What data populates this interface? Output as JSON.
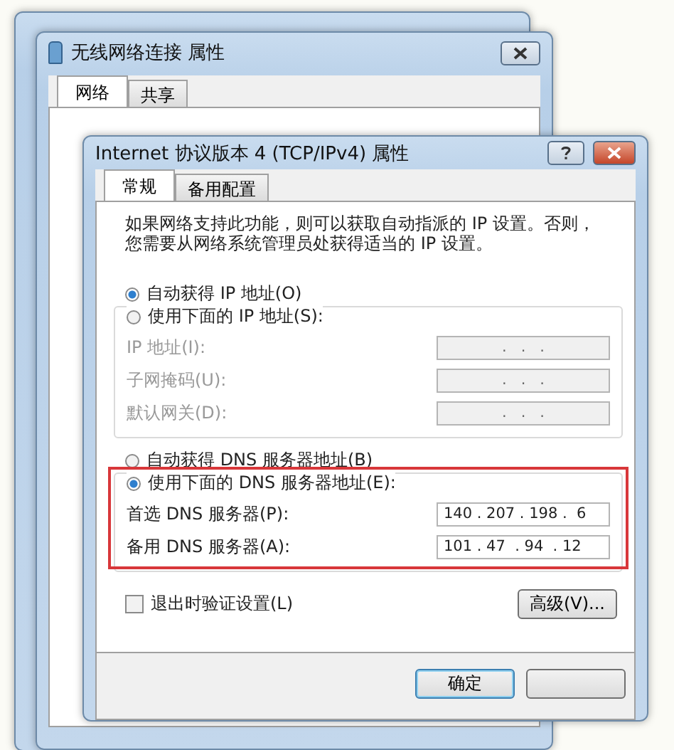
{
  "background_windows": [
    {
      "title": "无线网络连接 属性",
      "tabs": [
        {
          "label": "网络",
          "selected": true
        },
        {
          "label": "共享",
          "selected": false
        }
      ]
    }
  ],
  "dialog": {
    "title": "Internet 协议版本 4 (TCP/IPv4) 属性",
    "tabs": [
      {
        "label": "常规",
        "selected": true
      },
      {
        "label": "备用配置",
        "selected": false
      }
    ],
    "description": "如果网络支持此功能，则可以获取自动指派的 IP 设置。否则，您需要从网络系统管理员处获得适当的 IP 设置。",
    "ip_options": [
      {
        "label": "自动获得 IP 地址(O)",
        "selected": true
      },
      {
        "label": "使用下面的 IP 地址(S):",
        "selected": false
      }
    ],
    "ip_fields": [
      {
        "label": "IP 地址(I):",
        "value": ".   .   .",
        "disabled": true
      },
      {
        "label": "子网掩码(U):",
        "value": ".   .   .",
        "disabled": true
      },
      {
        "label": "默认网关(D):",
        "value": ".   .   .",
        "disabled": true
      }
    ],
    "dns_options": [
      {
        "label": "自动获得 DNS 服务器地址(B)",
        "selected": false
      },
      {
        "label": "使用下面的 DNS 服务器地址(E):",
        "selected": true
      }
    ],
    "dns_fields": [
      {
        "label": "首选 DNS 服务器(P):",
        "value": "140 . 207 . 198 .  6",
        "disabled": false
      },
      {
        "label": "备用 DNS 服务器(A):",
        "value": "101 . 47  . 94  . 12",
        "disabled": false
      }
    ],
    "dns_highlighted": true,
    "validate_checkbox": {
      "label": "退出时验证设置(L)",
      "checked": false
    },
    "advanced_button": "高级(V)...",
    "buttons": [
      "确定"
    ]
  }
}
